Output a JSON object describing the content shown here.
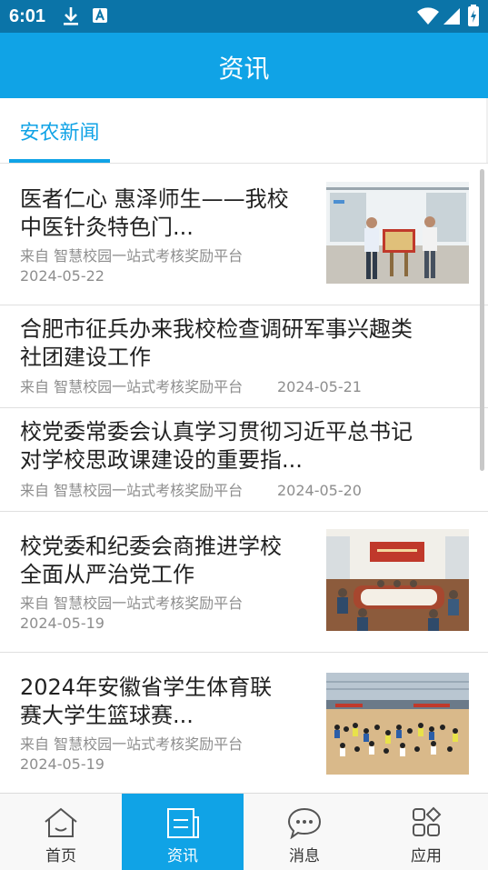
{
  "status": {
    "time": "6:01"
  },
  "header": {
    "title": "资讯"
  },
  "tabs": [
    {
      "label": "安农新闻"
    }
  ],
  "news": [
    {
      "title_line1": "医者仁心 惠泽师生——我校",
      "title_line2": "中医针灸特色门...",
      "source": "来自 智慧校园一站式考核奖励平台",
      "date": "2024-05-22"
    },
    {
      "title_line1": "合肥市征兵办来我校检查调研军事兴趣类",
      "title_line2": "社团建设工作",
      "source": "来自 智慧校园一站式考核奖励平台",
      "date": "2024-05-21"
    },
    {
      "title_line1": "校党委常委会认真学习贯彻习近平总书记",
      "title_line2": "对学校思政课建设的重要指...",
      "source": "来自 智慧校园一站式考核奖励平台",
      "date": "2024-05-20"
    },
    {
      "title_line1": "校党委和纪委会商推进学校",
      "title_line2": "全面从严治党工作",
      "source": "来自 智慧校园一站式考核奖励平台",
      "date": "2024-05-19"
    },
    {
      "title_line1": "2024年安徽省学生体育联",
      "title_line2": "赛大学生篮球赛...",
      "source": "来自 智慧校园一站式考核奖励平台",
      "date": "2024-05-19"
    }
  ],
  "nav": [
    {
      "label": "首页",
      "icon": "home-icon"
    },
    {
      "label": "资讯",
      "icon": "news-icon",
      "active": true
    },
    {
      "label": "消息",
      "icon": "message-icon"
    },
    {
      "label": "应用",
      "icon": "apps-icon"
    }
  ],
  "colors": {
    "primary": "#10a3e6",
    "statusbar": "#0b74a8"
  }
}
